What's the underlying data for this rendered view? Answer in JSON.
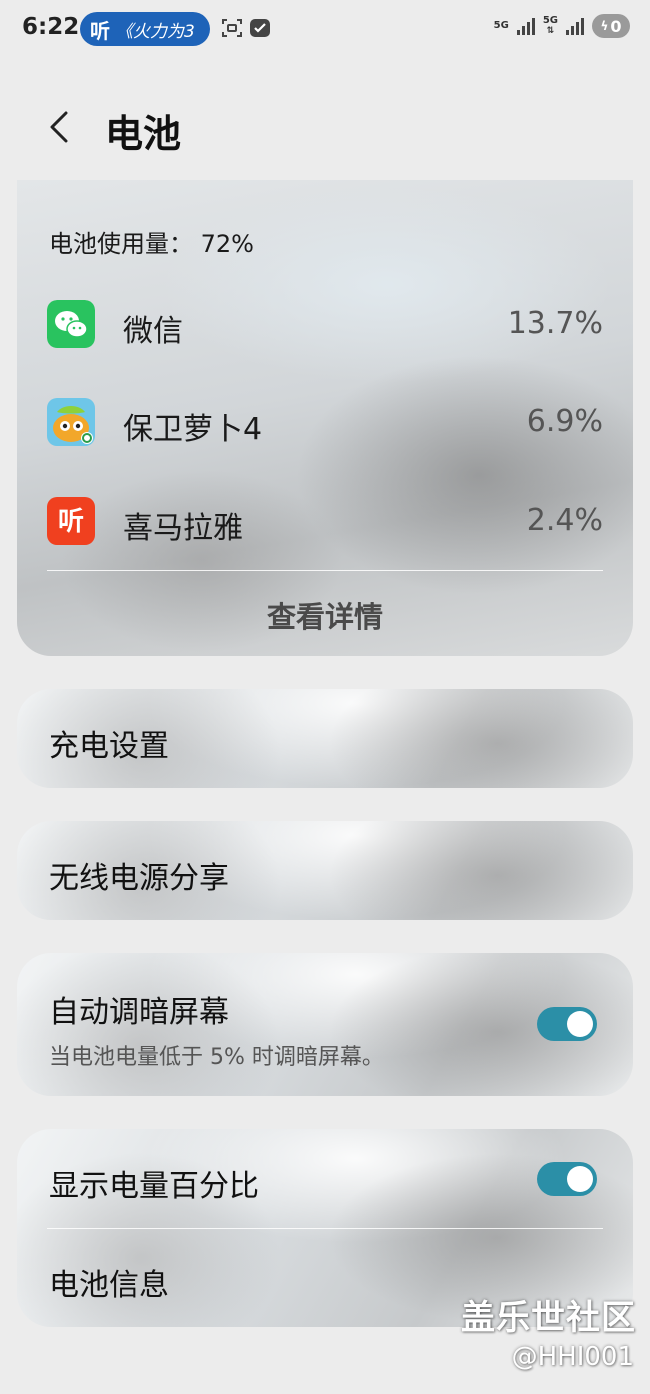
{
  "status_bar": {
    "time": "6:22",
    "notification_app_logo": "听",
    "notification_text": "《火力为3",
    "network_1": "5G",
    "network_2": "5G",
    "battery_icon": "charging-bolt-icon",
    "battery_value": "0"
  },
  "header": {
    "title": "电池"
  },
  "usage": {
    "label": "电池使用量：  72%",
    "apps": [
      {
        "name": "微信",
        "percent": "13.7%",
        "icon": "wechat-icon",
        "color": "#29c35f"
      },
      {
        "name": "保卫萝卜4",
        "percent": "6.9%",
        "icon": "carrot-game-icon",
        "color": "#8ed13b"
      },
      {
        "name": "喜马拉雅",
        "percent": "2.4%",
        "icon": "ximalaya-icon",
        "color": "#f0401f"
      }
    ],
    "details_label": "查看详情"
  },
  "settings": {
    "charging": "充电设置",
    "wireless_share": "无线电源分享",
    "auto_dim": {
      "label": "自动调暗屏幕",
      "description": "当电池电量低于 5% 时调暗屏幕。",
      "enabled": true
    },
    "show_percentage": {
      "label": "显示电量百分比",
      "enabled": true
    },
    "battery_info": "电池信息"
  },
  "colors": {
    "toggle_on": "#2b8fa7",
    "pill_blue": "#1e63b8"
  },
  "watermark": {
    "brand": "盖乐世社区",
    "user": "@HHI001"
  }
}
